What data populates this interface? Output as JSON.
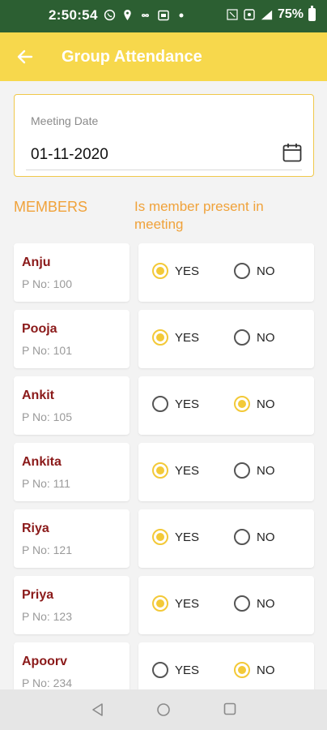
{
  "status_bar": {
    "time": "2:50:54",
    "battery": "75%",
    "icons": [
      "whatsapp-icon",
      "location-icon",
      "infinity-icon",
      "calendar-badge-icon",
      "dot-icon",
      "data-icon",
      "hotspot-icon",
      "signal-icon",
      "battery-icon"
    ]
  },
  "app_bar": {
    "title": "Group Attendance",
    "back_icon": "back-arrow-icon",
    "color": "#f7d84c"
  },
  "meeting": {
    "label": "Meeting Date",
    "value": "01-11-2020",
    "icon": "calendar-icon"
  },
  "columns": {
    "members": "MEMBERS",
    "present": "Is member present in meeting"
  },
  "options": {
    "yes": "YES",
    "no": "NO"
  },
  "members": [
    {
      "name": "Anju",
      "pno": "P No: 100",
      "present": "yes"
    },
    {
      "name": "Pooja",
      "pno": "P No: 101",
      "present": "yes"
    },
    {
      "name": "Ankit",
      "pno": "P No: 105",
      "present": "no"
    },
    {
      "name": "Ankita",
      "pno": "P No: 111",
      "present": "yes"
    },
    {
      "name": "Riya",
      "pno": "P No: 121",
      "present": "yes"
    },
    {
      "name": "Priya",
      "pno": "P No: 123",
      "present": "yes"
    },
    {
      "name": "Apoorv",
      "pno": "P No: 234",
      "present": "no"
    }
  ],
  "nav": {
    "back": "nav-back-icon",
    "home": "nav-home-icon",
    "recent": "nav-recent-icon"
  }
}
